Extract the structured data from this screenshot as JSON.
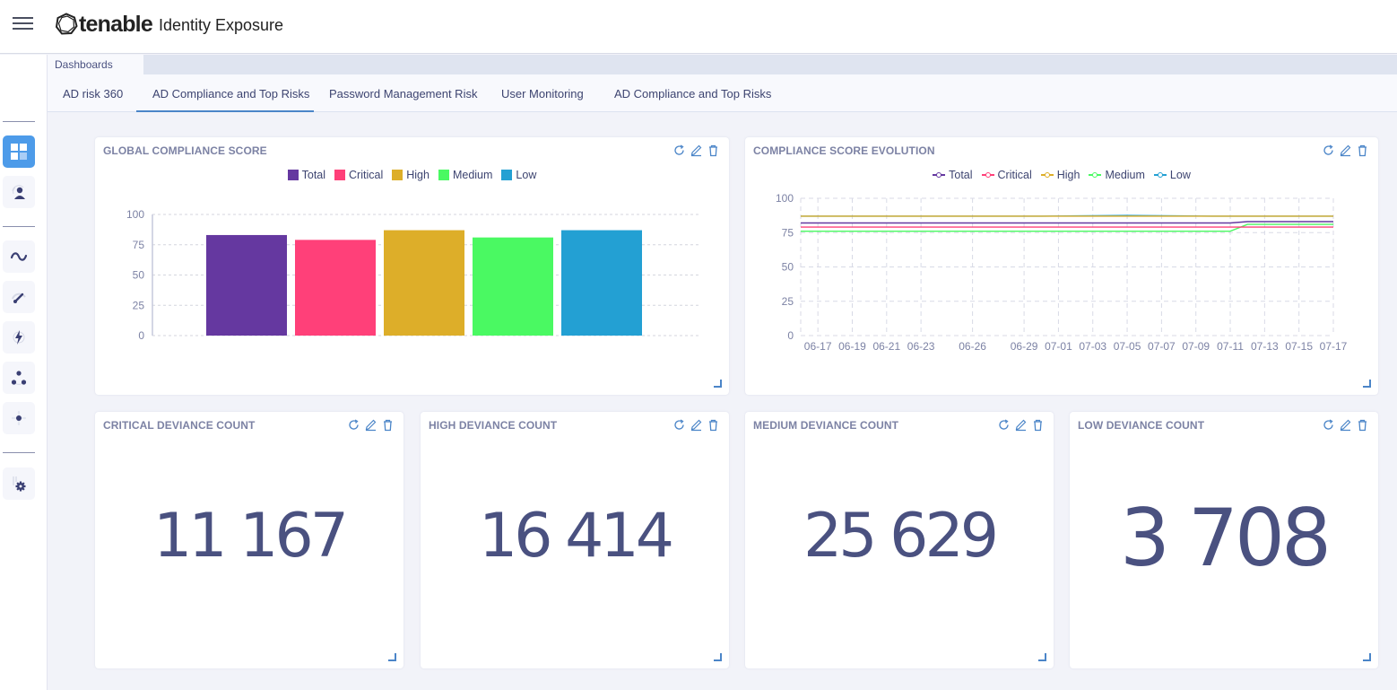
{
  "header": {
    "brand": "tenable",
    "product": "Identity Exposure",
    "menu_icon": "hamburger-menu-icon"
  },
  "sidebar": {
    "items": [
      {
        "name": "dashboards",
        "icon": "dashboard-grid-icon",
        "active": true
      },
      {
        "name": "identity-explorer",
        "icon": "fingerprint-user-icon",
        "active": false
      },
      {
        "name": "trail-flow",
        "icon": "wave-icon",
        "active": false
      },
      {
        "name": "indicators-of-exposure",
        "icon": "gauge-icon",
        "active": false
      },
      {
        "name": "indicators-of-attack",
        "icon": "lightning-icon",
        "active": false
      },
      {
        "name": "topology",
        "icon": "topology-nodes-icon",
        "active": false
      },
      {
        "name": "attack-path",
        "icon": "attack-path-icon",
        "active": false
      },
      {
        "name": "system-settings",
        "icon": "settings-gear-icon",
        "active": false
      }
    ]
  },
  "breadcrumb": "Dashboards",
  "tabs": [
    {
      "label": "AD risk 360",
      "active": false
    },
    {
      "label": "AD Compliance and Top Risks",
      "active": true
    },
    {
      "label": "Password Management Risk",
      "active": false
    },
    {
      "label": "User Monitoring",
      "active": false
    },
    {
      "label": "AD Compliance and Top Risks",
      "active": false
    }
  ],
  "widgets": {
    "global_score": {
      "title": "GLOBAL COMPLIANCE SCORE"
    },
    "evolution": {
      "title": "COMPLIANCE SCORE EVOLUTION"
    },
    "critical": {
      "title": "CRITICAL DEVIANCE COUNT",
      "value": "11 167"
    },
    "high": {
      "title": "HIGH DEVIANCE COUNT",
      "value": "16 414"
    },
    "medium": {
      "title": "MEDIUM DEVIANCE COUNT",
      "value": "25 629"
    },
    "low": {
      "title": "LOW DEVIANCE COUNT",
      "value": "3 708"
    },
    "actions": [
      "refresh-icon",
      "edit-pencil-icon",
      "delete-trash-icon"
    ]
  },
  "colors": {
    "Total": "#6538a0",
    "Critical": "#ff4079",
    "High": "#ddae29",
    "Medium": "#4af962",
    "Low": "#23a0d3",
    "accent": "#4d9be9",
    "number": "#4a5180"
  },
  "chart_data": [
    {
      "type": "bar",
      "title": "GLOBAL COMPLIANCE SCORE",
      "categories": [
        "Total",
        "Critical",
        "High",
        "Medium",
        "Low"
      ],
      "values": [
        83,
        79,
        87,
        81,
        87
      ],
      "legend": [
        "Total",
        "Critical",
        "High",
        "Medium",
        "Low"
      ],
      "legend_position": "top-center",
      "ylim": [
        0,
        100
      ],
      "yticks": [
        0,
        25,
        50,
        75,
        100
      ],
      "grid": true,
      "xlabel": "",
      "ylabel": ""
    },
    {
      "type": "line",
      "title": "COMPLIANCE SCORE EVOLUTION",
      "x_range": [
        "06-16",
        "07-17"
      ],
      "xticks": [
        "06-17",
        "06-19",
        "06-21",
        "06-23",
        "06-26",
        "06-29",
        "07-01",
        "07-03",
        "07-05",
        "07-07",
        "07-09",
        "07-11",
        "07-13",
        "07-15",
        "07-17"
      ],
      "yticks": [
        0,
        25,
        50,
        75,
        100
      ],
      "ylim": [
        0,
        100
      ],
      "grid": true,
      "legend_position": "top-center",
      "x": [
        "06-16",
        "06-20",
        "06-25",
        "06-30",
        "07-05",
        "07-10",
        "07-11",
        "07-12",
        "07-14",
        "07-17"
      ],
      "series": [
        {
          "name": "Total",
          "values": [
            82,
            82,
            82,
            82,
            82,
            82,
            82,
            83,
            83,
            83
          ]
        },
        {
          "name": "Critical",
          "values": [
            79,
            79,
            79,
            79,
            79,
            79,
            79,
            79,
            79,
            79
          ]
        },
        {
          "name": "High",
          "values": [
            87,
            87,
            87,
            87,
            87,
            87,
            87,
            87,
            87,
            87
          ]
        },
        {
          "name": "Medium",
          "values": [
            76,
            76,
            76,
            76,
            76,
            76,
            76,
            81,
            81,
            81
          ]
        },
        {
          "name": "Low",
          "values": [
            87,
            87,
            87,
            87,
            87.5,
            87,
            87,
            87,
            87,
            87
          ]
        }
      ]
    }
  ]
}
